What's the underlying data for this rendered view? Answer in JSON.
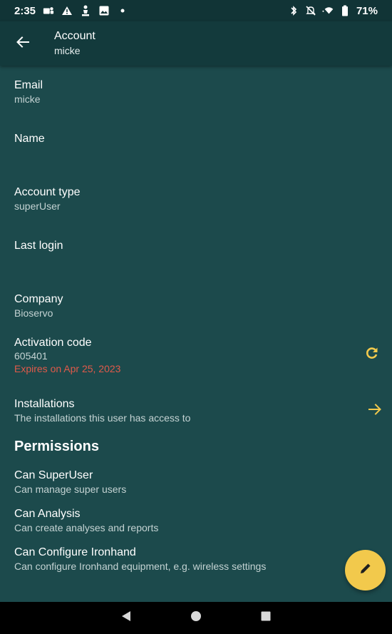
{
  "status_bar": {
    "time": "2:35",
    "battery": "71%"
  },
  "app_bar": {
    "title": "Account",
    "subtitle": "micke"
  },
  "fields": {
    "email": {
      "label": "Email",
      "value": "micke"
    },
    "name": {
      "label": "Name",
      "value": ""
    },
    "account_type": {
      "label": "Account type",
      "value": "superUser"
    },
    "last_login": {
      "label": "Last login",
      "value": ""
    },
    "company": {
      "label": "Company",
      "value": "Bioservo"
    },
    "activation_code": {
      "label": "Activation code",
      "value": "605401",
      "expiry": "Expires on Apr 25, 2023"
    },
    "installations": {
      "label": "Installations",
      "description": "The installations this user has access to"
    }
  },
  "permissions": {
    "title": "Permissions",
    "items": [
      {
        "label": "Can SuperUser",
        "description": "Can manage super users"
      },
      {
        "label": "Can Analysis",
        "description": "Can create analyses and reports"
      },
      {
        "label": "Can Configure Ironhand",
        "description": "Can configure Ironhand equipment, e.g. wireless settings"
      }
    ]
  },
  "icons": {
    "back": "arrow-left-icon",
    "refresh": "refresh-icon",
    "forward": "arrow-right-icon",
    "edit": "pencil-icon"
  },
  "colors": {
    "background": "#1c4a4c",
    "app_bar": "#133a3c",
    "accent": "#f2c94c",
    "warning": "#e05a4a"
  }
}
